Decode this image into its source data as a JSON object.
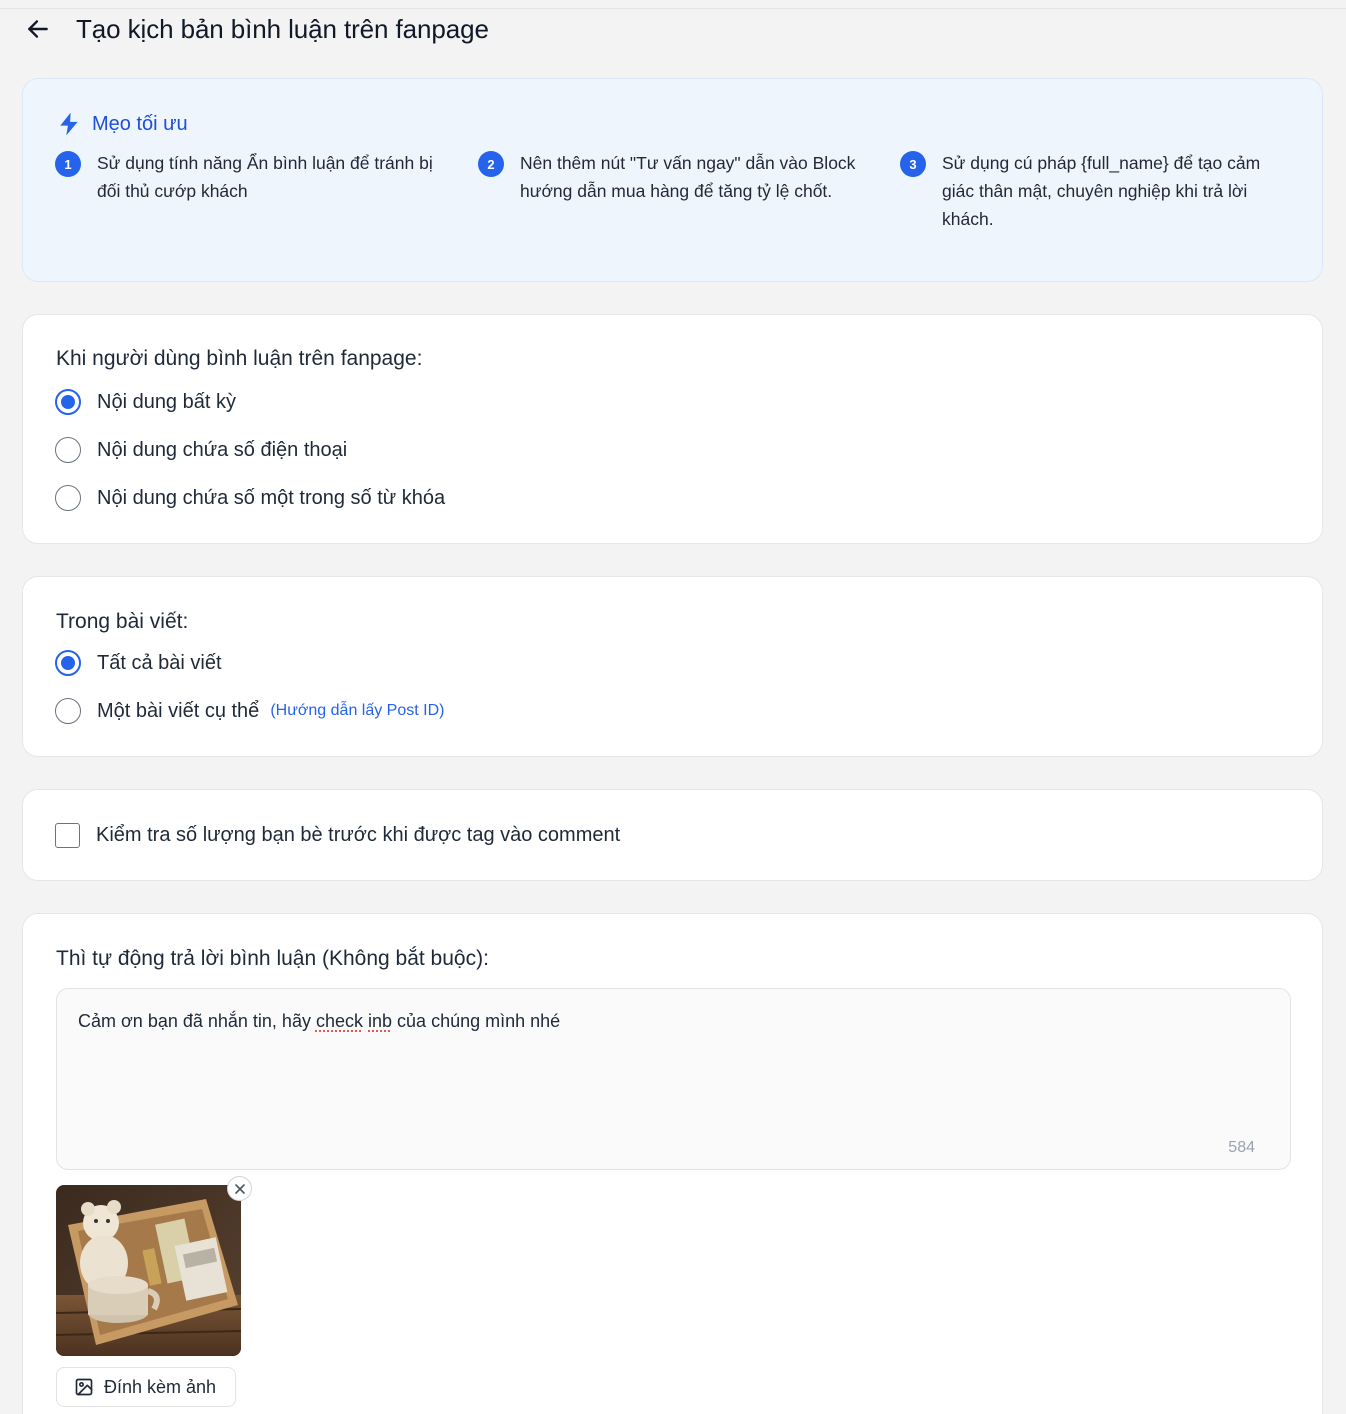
{
  "header": {
    "title": "Tạo kịch bản bình luận trên fanpage"
  },
  "tips": {
    "title": "Mẹo tối ưu",
    "items": [
      {
        "num": "1",
        "text_line1": "Sử dụng tính năng Ẩn bình luận để tránh bị",
        "text_line2": "đối thủ cướp khách",
        "text_line3": ""
      },
      {
        "num": "2",
        "text_line1": "Nên thêm nút \"Tư vấn ngay\" dẫn vào Block",
        "text_line2": "hướng dẫn mua hàng để tăng tỷ lệ chốt.",
        "text_line3": ""
      },
      {
        "num": "3",
        "text_line1": "Sử dụng cú pháp {full_name} để tạo cảm",
        "text_line2": "giác thân mật, chuyên nghiệp khi trả lời",
        "text_line3": "khách."
      }
    ]
  },
  "trigger": {
    "label": "Khi người dùng bình luận trên fanpage:",
    "options": [
      {
        "label": "Nội dung bất kỳ",
        "selected": true
      },
      {
        "label": "Nội dung chứa số điện thoại",
        "selected": false
      },
      {
        "label": "Nội dung chứa số một trong số từ khóa",
        "selected": false
      }
    ]
  },
  "posts": {
    "label": "Trong bài viết:",
    "options": [
      {
        "label": "Tất cả bài viết",
        "selected": true
      },
      {
        "label": "Một bài viết cụ thể",
        "selected": false
      }
    ],
    "post_id_hint": "(Hướng dẫn lấy Post ID)"
  },
  "friend_check": {
    "label": "Kiểm tra số lượng bạn bè trước khi được tag vào comment",
    "checked": false
  },
  "reply": {
    "label": "Thì tự động trả lời bình luận (Không bắt buộc):",
    "text_before": "Cảm ơn bạn đã nhắn tin, hãy ",
    "text_word1": "check",
    "text_space": " ",
    "text_word2": "inb",
    "text_after": " của chúng mình nhé",
    "char_count": "584",
    "attach_label": "Đính kèm ảnh"
  },
  "colors": {
    "accent": "#2563eb",
    "tips_bg": "#eef5fd",
    "page_bg": "#f3f3f3"
  }
}
